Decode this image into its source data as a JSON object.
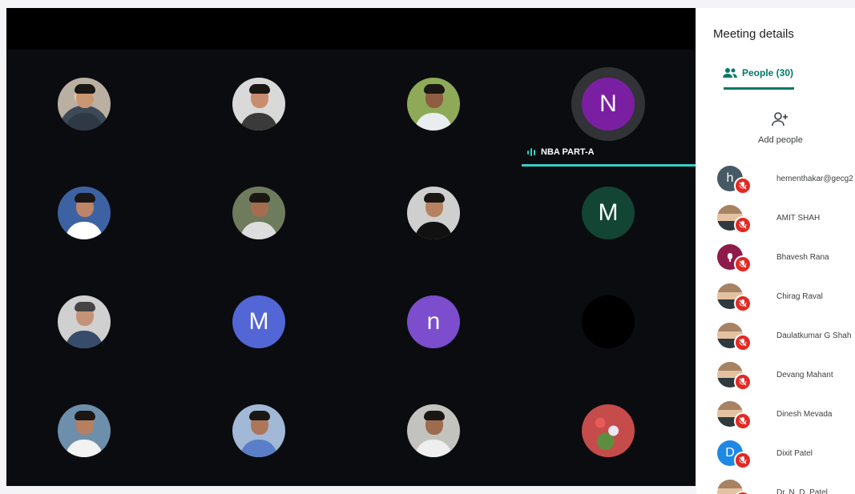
{
  "stage": {
    "speaker": "NBA PART-A",
    "tiles": [
      {
        "kind": "photo",
        "name": "participant-1",
        "color": "#8c7d6f"
      },
      {
        "kind": "photo",
        "name": "participant-2",
        "color": "#d9d9d9"
      },
      {
        "kind": "photo",
        "name": "participant-3",
        "color": "#9ab36b"
      },
      {
        "kind": "letter",
        "letter": "N",
        "color": "#7b1fa2",
        "speaking": true
      },
      {
        "kind": "photo",
        "name": "participant-5",
        "color": "#3d62a3"
      },
      {
        "kind": "photo",
        "name": "participant-6",
        "color": "#6e7c5d"
      },
      {
        "kind": "photo",
        "name": "participant-7",
        "color": "#cfcfcf"
      },
      {
        "kind": "letter",
        "letter": "M",
        "color": "#124534"
      },
      {
        "kind": "photo",
        "name": "participant-9",
        "color": "#d0d0d0"
      },
      {
        "kind": "letter",
        "letter": "M",
        "color": "#5266d6"
      },
      {
        "kind": "letter",
        "letter": "n",
        "color": "#7c4dcc"
      },
      {
        "kind": "blank",
        "color": "#000000"
      },
      {
        "kind": "photo",
        "name": "participant-13",
        "color": "#6d8fab"
      },
      {
        "kind": "photo",
        "name": "participant-14",
        "color": "#a2b8d7"
      },
      {
        "kind": "photo",
        "name": "participant-15",
        "color": "#c2c2bf"
      },
      {
        "kind": "photo",
        "name": "participant-16",
        "color": "#c64b4b"
      }
    ]
  },
  "panel": {
    "title": "Meeting details",
    "tab_label": "People (30)",
    "add_people": "Add people",
    "people": [
      {
        "name": "hementhakar@gecg2",
        "avatar": "letter",
        "letter": "h",
        "color": "#455a64"
      },
      {
        "name": "AMIT SHAH",
        "avatar": "photo",
        "color": "#556b4d"
      },
      {
        "name": "Bhavesh Rana",
        "avatar": "icon",
        "color": "#8e1b49"
      },
      {
        "name": "Chirag Raval",
        "avatar": "photo",
        "color": "#4d5a79"
      },
      {
        "name": "Daulatkumar G Shah",
        "avatar": "photo",
        "color": "#993344"
      },
      {
        "name": "Devang Mahant",
        "avatar": "photo",
        "color": "#f0f0f0"
      },
      {
        "name": "Dinesh Mevada",
        "avatar": "photo",
        "color": "#e8d04d"
      },
      {
        "name": "Dixit Patel",
        "avatar": "letter",
        "letter": "D",
        "color": "#1e88e5"
      },
      {
        "name": "Dr. N. D. Patel",
        "avatar": "photo",
        "color": "#3e6c8c"
      }
    ]
  },
  "colors": {
    "accent": "#00796b",
    "speaking": "#35d0c6",
    "muted": "#e52822"
  }
}
